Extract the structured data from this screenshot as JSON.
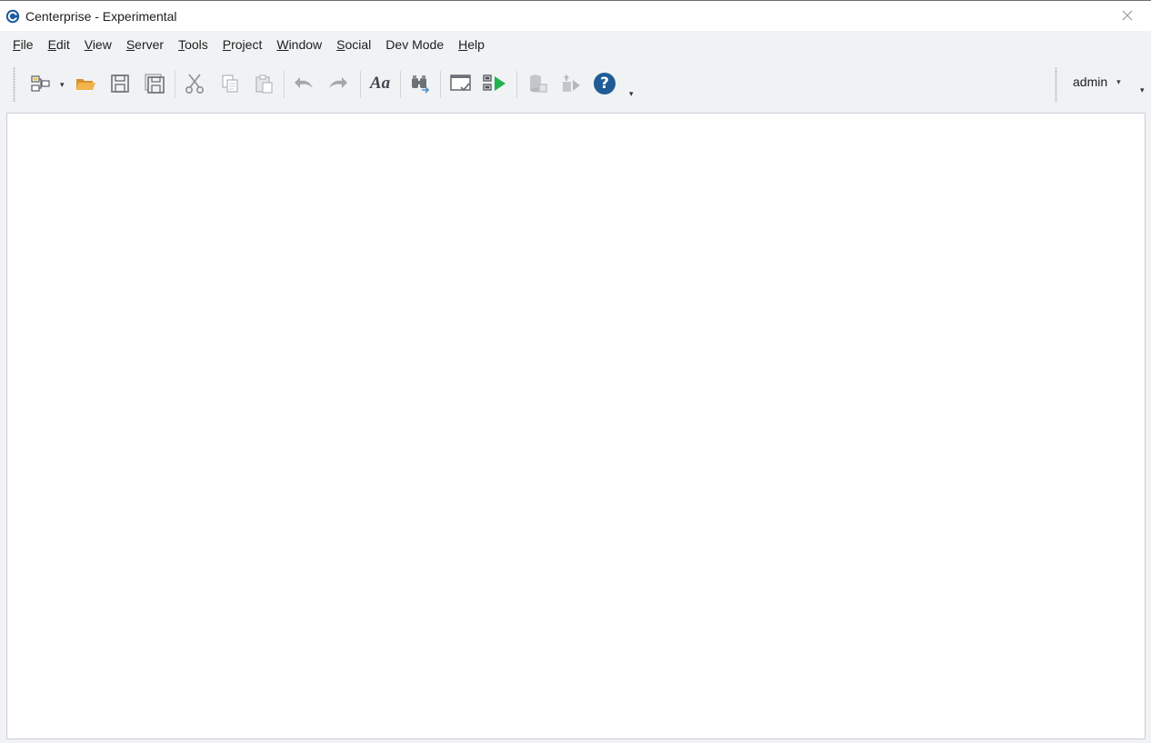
{
  "window": {
    "title": "Centerprise - Experimental",
    "logo_icon": "centerprise-logo-icon",
    "close_icon": "close-icon"
  },
  "menubar": {
    "items": [
      {
        "mnemonic": "F",
        "rest": "ile"
      },
      {
        "mnemonic": "E",
        "rest": "dit"
      },
      {
        "mnemonic": "V",
        "rest": "iew"
      },
      {
        "mnemonic": "S",
        "rest": "erver"
      },
      {
        "mnemonic": "T",
        "rest": "ools"
      },
      {
        "mnemonic": "P",
        "rest": "roject"
      },
      {
        "mnemonic": "W",
        "rest": "indow"
      },
      {
        "mnemonic": "S",
        "rest": "ocial"
      },
      {
        "mnemonic": "",
        "rest": "Dev Mode"
      },
      {
        "mnemonic": "H",
        "rest": "elp"
      }
    ]
  },
  "toolbar": {
    "buttons": [
      "new-flow-icon",
      "open-folder-icon",
      "save-icon",
      "save-all-icon",
      "cut-icon",
      "copy-icon",
      "paste-icon",
      "undo-icon",
      "redo-icon",
      "font-icon",
      "find-icon",
      "verify-icon",
      "run-icon",
      "database-icon",
      "deploy-icon",
      "help-icon"
    ],
    "font_label": "Aa",
    "help_label": "?",
    "overflow_glyph": "▾",
    "dropdown_glyph": "▾"
  },
  "user": {
    "name": "admin",
    "caret": "▾"
  },
  "colors": {
    "brand": "#1d5b9c",
    "folder": "#e8a33a",
    "run_green": "#22b14c",
    "help_blue": "#1f5c96",
    "icon_gray": "#5a6066",
    "disabled_gray": "#b5b9be"
  }
}
